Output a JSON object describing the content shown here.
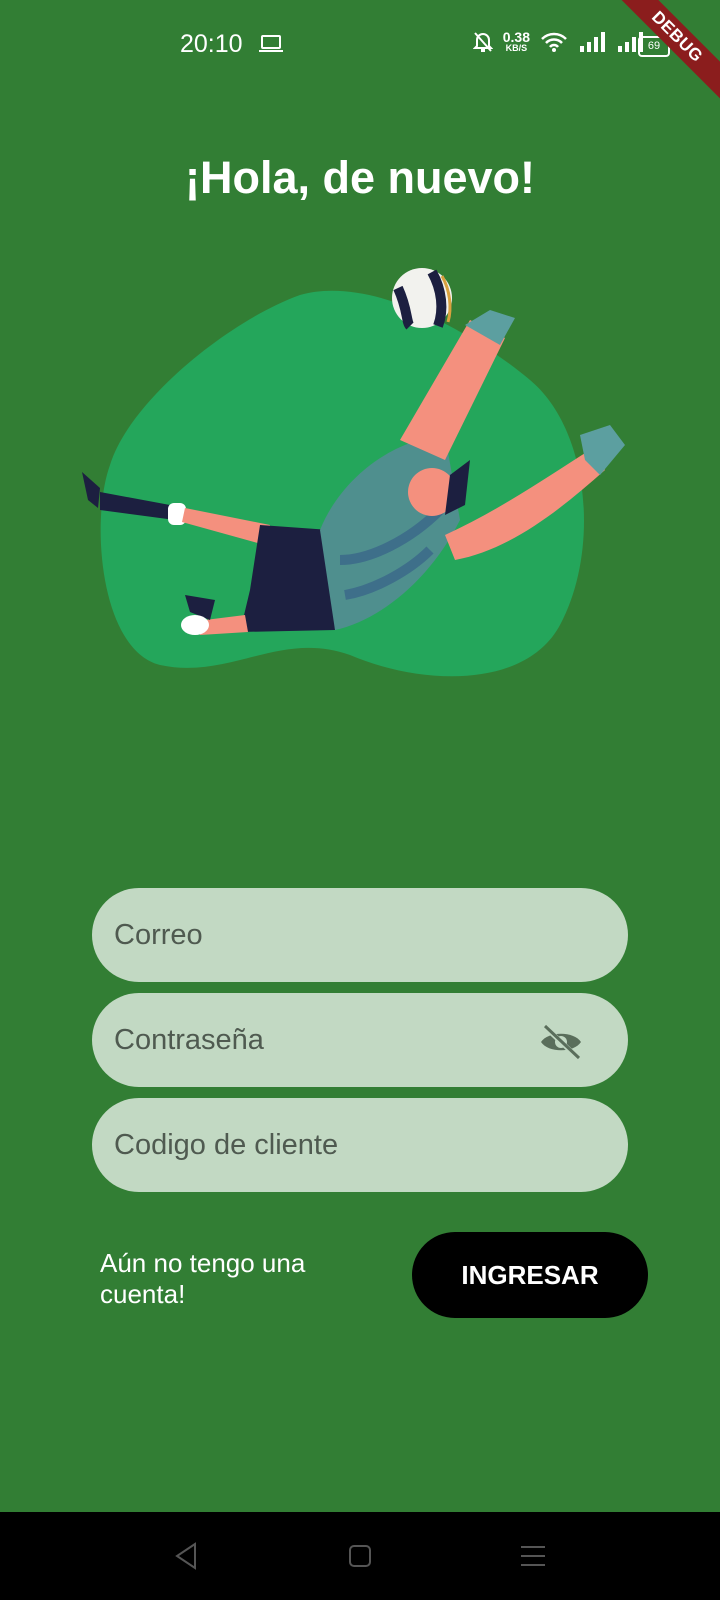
{
  "status_bar": {
    "time": "20:10",
    "net_speed_value": "0.38",
    "net_speed_unit": "KB/S",
    "battery": "69"
  },
  "debug_banner": "DEBUG",
  "page": {
    "title": "¡Hola, de nuevo!"
  },
  "form": {
    "email_placeholder": "Correo",
    "password_placeholder": "Contraseña",
    "client_code_placeholder": "Codigo de cliente",
    "register_link": "Aún no tengo una cuenta!",
    "login_button": "INGRESAR"
  },
  "colors": {
    "background": "#327e34",
    "blob": "#24a65b",
    "field": "#c2d9c3",
    "button": "#000000"
  },
  "icons": [
    "laptop-icon",
    "bell-off-icon",
    "wifi-icon",
    "signal-icon",
    "battery-icon",
    "eye-off-icon",
    "nav-back-icon",
    "nav-home-icon",
    "nav-menu-icon"
  ]
}
